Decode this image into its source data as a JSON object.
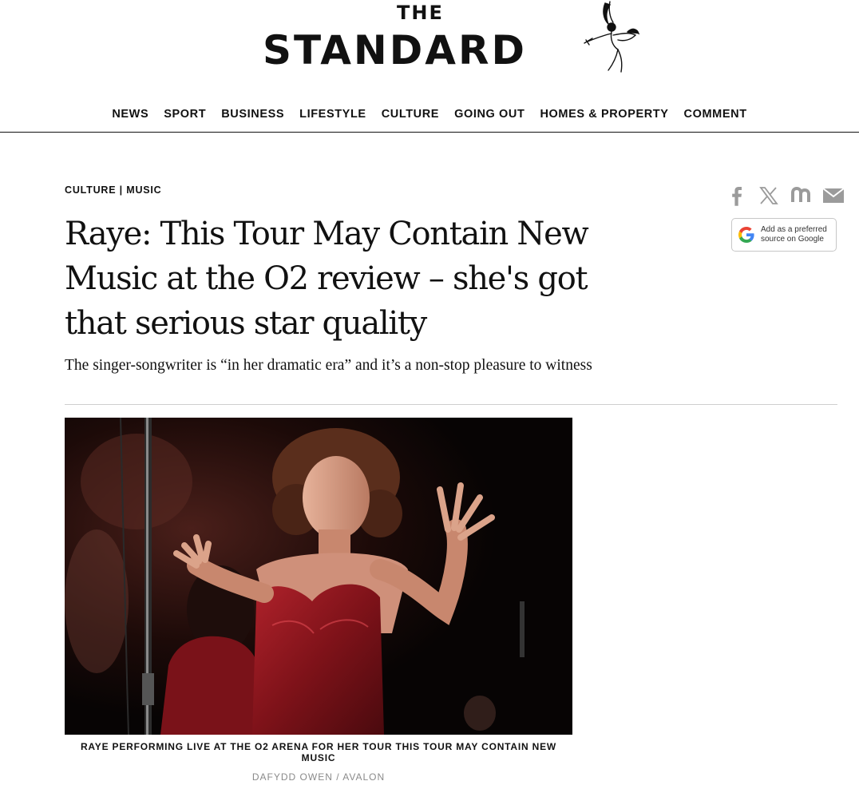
{
  "masthead": {
    "the": "THE",
    "standard": "STANDARD"
  },
  "nav": {
    "items": [
      "NEWS",
      "SPORT",
      "BUSINESS",
      "LIFESTYLE",
      "CULTURE",
      "GOING OUT",
      "HOMES & PROPERTY",
      "COMMENT"
    ]
  },
  "article": {
    "breadcrumb": "CULTURE | MUSIC",
    "headline": "Raye: This Tour May Contain New Music at the O2 review – she's got that serious star quality",
    "standfirst": "The singer-songwriter is “in her dramatic era” and it’s a non-stop pleasure to witness",
    "image": {
      "caption": "RAYE PERFORMING LIVE AT THE O2 ARENA FOR HER TOUR THIS TOUR MAY CONTAIN NEW MUSIC",
      "credit": "DAFYDD OWEN / AVALON"
    }
  },
  "share": {
    "icons": [
      "facebook-icon",
      "x-icon",
      "newsnow-icon",
      "email-icon"
    ],
    "icon_color": "#9b9b9b"
  },
  "google_source": {
    "line1": "Add as a preferred",
    "line2": "source on Google"
  },
  "colors": {
    "text": "#111111",
    "rule": "#cfcfcf",
    "credit": "#8a8a8a"
  }
}
